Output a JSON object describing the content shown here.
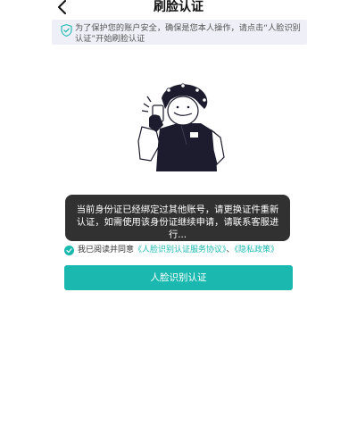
{
  "header": {
    "title": "刷脸认证",
    "back_icon": "chevron-left-icon"
  },
  "notice": {
    "icon": "shield-check-icon",
    "text": "为了保护您的账户安全，确保是您本人操作，请点击“人脸识别认证”开始刷脸认证"
  },
  "illustration": {
    "name": "person-holding-phone-illustration"
  },
  "toast": {
    "message": "当前身份证已经绑定过其他账号，请更换证件重新认证，如需使用该身份证继续申请，请联系客服进行..."
  },
  "agreement": {
    "checked": true,
    "prefix": "我已阅读并同意",
    "service_link": "《人脸识别认证服务协议》",
    "separator": "、",
    "privacy_link": "《隐私政策》"
  },
  "primary_button": {
    "label": "人脸识别认证"
  },
  "colors": {
    "accent": "#1bb8b0",
    "notice_bg": "#efeff7",
    "toast_bg": "#141414"
  }
}
